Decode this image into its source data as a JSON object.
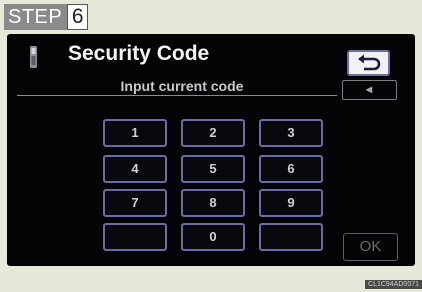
{
  "step": {
    "label": "STEP",
    "number": "6"
  },
  "header": {
    "title": "Security Code"
  },
  "instruction": "Input current code",
  "display": {
    "mark": "◂"
  },
  "keypad": {
    "keys": [
      "1",
      "2",
      "3",
      "4",
      "5",
      "6",
      "7",
      "8",
      "9",
      "",
      "0",
      ""
    ]
  },
  "ok_label": "OK",
  "figure_code": "CL1C94AD0071"
}
